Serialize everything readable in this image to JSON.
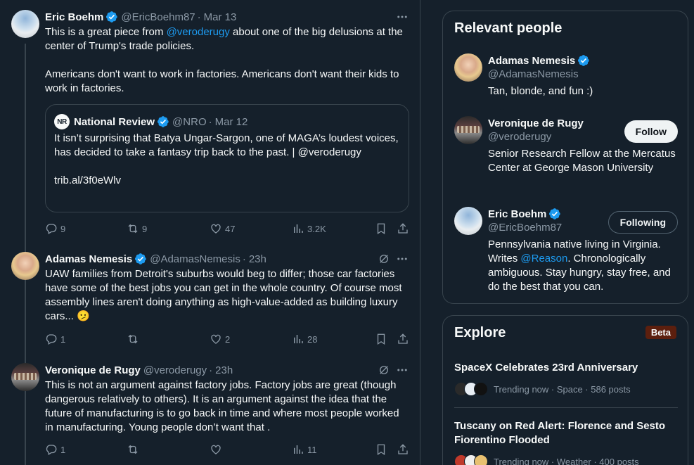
{
  "colors": {
    "background": "#15202b",
    "accent": "#1d9bf0",
    "border": "#38444d",
    "muted": "#8b98a5",
    "beta_bg": "#5c1f0e"
  },
  "tweets": [
    {
      "name": "Eric Boehm",
      "handle": "@EricBoehm87",
      "dot": "·",
      "time": "Mar 13",
      "text_1a": "This is a great piece from ",
      "text_1link": "@veroderugy",
      "text_1b": " about one of the big delusions at the center of Trump's trade policies.",
      "text_2": "Americans don't want to work in factories. Americans don't want their kids to work in factories.",
      "quote": {
        "logo": "NR",
        "name": "National Review",
        "handle": "@NRO",
        "dot": "·",
        "time": "Mar 12",
        "text": "It isn’t surprising that Batya Ungar-Sargon, one of MAGA’s loudest voices, has decided to take a fantasy trip back to the past. | @veroderugy",
        "link": "trib.al/3f0eWlv"
      },
      "replies": "9",
      "reposts": "9",
      "likes": "47",
      "views": "3.2K"
    },
    {
      "name": "Adamas Nemesis",
      "handle": "@AdamasNemesis",
      "dot": "·",
      "time": "23h",
      "text": "UAW families from Detroit's suburbs would beg to differ; those car factories have some of the best jobs you can get in the whole country. Of course most assembly lines aren't doing anything as high-value-added as building luxury cars...",
      "emoji": "🫤",
      "replies": "1",
      "reposts": "",
      "likes": "2",
      "views": "28"
    },
    {
      "name": "Veronique de Rugy",
      "handle": "@veroderugy",
      "dot": "·",
      "time": "23h",
      "text": "This is not an argument against factory jobs. Factory jobs are great (though dangerous relatively to others). It is an argument against the idea that the future of manufacturing is to go back in time and where most people worked in manufacturing. Young people don’t want that .",
      "replies": "1",
      "reposts": "",
      "likes": "",
      "views": "11"
    }
  ],
  "relevant": {
    "title": "Relevant people",
    "people": [
      {
        "name": "Adamas Nemesis",
        "handle": "@AdamasNemesis",
        "bio": "Tan, blonde, and fun :)",
        "button": ""
      },
      {
        "name": "Veronique de Rugy",
        "handle": "@veroderugy",
        "bio": "Senior Research Fellow at the Mercatus Center at George Mason University",
        "button": "Follow"
      },
      {
        "name": "Eric Boehm",
        "handle": "@EricBoehm87",
        "bio_a": "Pennsylvania native living in Virginia. Writes ",
        "bio_link": "@Reason",
        "bio_b": ". Chronologically ambiguous. Stay hungry, stay free, and do the best that you can.",
        "button": "Following"
      }
    ]
  },
  "explore": {
    "title": "Explore",
    "badge": "Beta",
    "trends": [
      {
        "title": "SpaceX Celebrates 23rd Anniversary",
        "meta": "Trending now · Space · 586 posts"
      },
      {
        "title": "Tuscany on Red Alert: Florence and Sesto Fiorentino Flooded",
        "meta": "Trending now · Weather · 400 posts"
      }
    ]
  }
}
